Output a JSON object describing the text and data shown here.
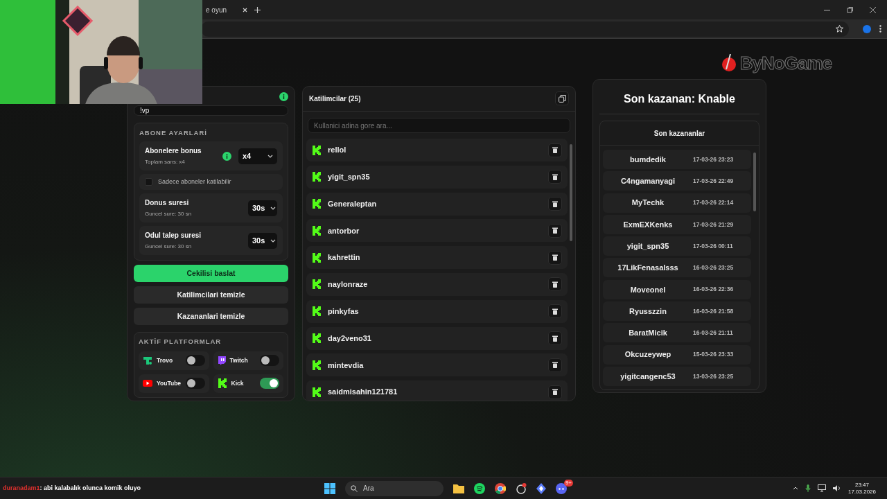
{
  "browser": {
    "tab_title": "e oyun"
  },
  "logo": {
    "text": "ByNoGame"
  },
  "settings": {
    "command_value": "!vp",
    "subscriber_section": {
      "title": "ABONE AYARLARİ",
      "bonus": {
        "label": "Abonelere bonus",
        "sub": "Toplam sans: x4",
        "value": "x4"
      },
      "subs_only": {
        "label": "Sadece aboneler katilabilir",
        "checked": false
      },
      "timers": [
        {
          "label": "Donus suresi",
          "sub": "Guncel sure: 30 sn",
          "value": "30s"
        },
        {
          "label": "Odul talep suresi",
          "sub": "Guncel sure: 30 sn",
          "value": "30s"
        }
      ]
    },
    "buttons": [
      {
        "label": "Cekilisi baslat",
        "kind": "primary"
      },
      {
        "label": "Katilimcilari temizle",
        "kind": "secondary"
      },
      {
        "label": "Kazananlari temizle",
        "kind": "secondary"
      }
    ],
    "platforms": {
      "title": "AKTİF PLATFORMLAR",
      "items": [
        {
          "name": "Trovo",
          "kind": "trovo",
          "on": false
        },
        {
          "name": "Twitch",
          "kind": "twitch",
          "on": false
        },
        {
          "name": "YouTube",
          "kind": "youtube",
          "on": false
        },
        {
          "name": "Kick",
          "kind": "kick",
          "on": true
        }
      ]
    }
  },
  "participants": {
    "title": "Katilimcilar (25)",
    "search_placeholder": "Kullanici adina gore ara...",
    "rows": [
      {
        "name": "rellol",
        "kind": "kick"
      },
      {
        "name": "yigit_spn35",
        "kind": "kick"
      },
      {
        "name": "Generaleptan",
        "kind": "kick"
      },
      {
        "name": "antorbor",
        "kind": "kick"
      },
      {
        "name": "kahrettin",
        "kind": "kick"
      },
      {
        "name": "naylonraze",
        "kind": "kick"
      },
      {
        "name": "pinkyfas",
        "kind": "kick"
      },
      {
        "name": "day2veno31",
        "kind": "kick"
      },
      {
        "name": "mintevdia",
        "kind": "kick"
      },
      {
        "name": "saidmisahin121781",
        "kind": "kick"
      }
    ]
  },
  "winners": {
    "title": "Son kazanan: Knable",
    "list_title": "Son kazananlar",
    "rows": [
      {
        "name": "bumdedik",
        "date": "17-03-26 23:23"
      },
      {
        "name": "C4ngamanyagi",
        "date": "17-03-26 22:49"
      },
      {
        "name": "MyTechk",
        "date": "17-03-26 22:14"
      },
      {
        "name": "ExmEXKenks",
        "date": "17-03-26 21:29"
      },
      {
        "name": "yigit_spn35",
        "date": "17-03-26 00:11"
      },
      {
        "name": "17LikFenasalsss",
        "date": "16-03-26 23:25"
      },
      {
        "name": "Moveonel",
        "date": "16-03-26 22:36"
      },
      {
        "name": "Ryusszzin",
        "date": "16-03-26 21:58"
      },
      {
        "name": "BaratMicik",
        "date": "16-03-26 21:11"
      },
      {
        "name": "Okcuzeywep",
        "date": "15-03-26 23:33"
      },
      {
        "name": "yigitcangenc53",
        "date": "13-03-26 23:25"
      }
    ]
  },
  "chat": {
    "user": "duranadam1",
    "message": ": abi kalabalık olunca komik oluyo"
  },
  "taskbar": {
    "search_placeholder": "Ara",
    "badge": "9+",
    "time": "23:47",
    "date": "17.03.2026"
  }
}
